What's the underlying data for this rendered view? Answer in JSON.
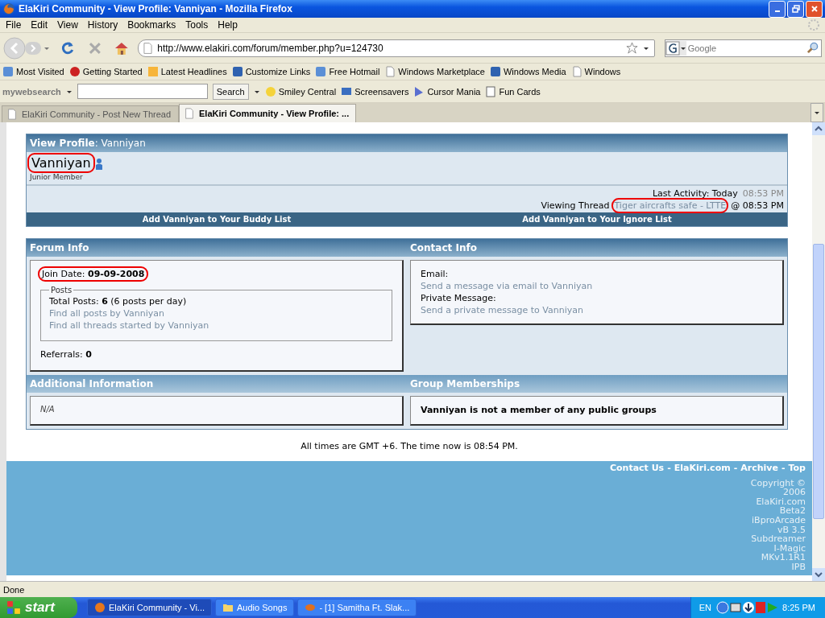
{
  "window": {
    "title": "ElaKiri Community - View Profile: Vanniyan - Mozilla Firefox"
  },
  "menu": [
    "File",
    "Edit",
    "View",
    "History",
    "Bookmarks",
    "Tools",
    "Help"
  ],
  "navigation": {
    "url": "http://www.elakiri.com/forum/member.php?u=124730",
    "search_placeholder": "Google"
  },
  "bookmarks": [
    "Most Visited",
    "Getting Started",
    "Latest Headlines",
    "Customize Links",
    "Free Hotmail",
    "Windows Marketplace",
    "Windows Media",
    "Windows"
  ],
  "search_toolbar": {
    "brand": "mywebsearch",
    "button": "Search",
    "items": [
      "Smiley Central",
      "Screensavers",
      "Cursor Mania",
      "Fun Cards"
    ]
  },
  "tabs": [
    {
      "label": "ElaKiri Community - Post New Thread",
      "selected": false
    },
    {
      "label": "ElaKiri Community - View Profile: ...",
      "selected": true
    }
  ],
  "profile": {
    "header": "**View Profile**: Vanniyan",
    "username": "Vanniyan",
    "rank": "Junior Member",
    "last_activity": "Last Activity: Today",
    "last_activity_time": "08:53 PM",
    "viewing_label": "Viewing Thread",
    "viewing_thread": "Tiger aircrafts safe - LTTE",
    "viewing_time": "@ 08:53 PM",
    "buddy_link": "Add Vanniyan to Your Buddy List",
    "ignore_link": "Add Vanniyan to Your Ignore List"
  },
  "forum_info": {
    "title": "Forum Info",
    "join_date": "Join Date: **09-09-2008**",
    "posts_legend": "Posts",
    "total_posts": "Total Posts: **6** (6 posts per day)",
    "links": [
      "Find all posts by Vanniyan",
      "Find all threads started by Vanniyan"
    ],
    "referrals": "Referrals: **0**"
  },
  "contact_info": {
    "title": "Contact Info",
    "fields": [
      {
        "label": "Email:",
        "link": "Send a message via email to Vanniyan"
      },
      {
        "label": "Private Message:",
        "link": "Send a private message to Vanniyan"
      }
    ]
  },
  "additional_info": {
    "title": "Additional Information",
    "value": "N/A"
  },
  "group_memberships": {
    "title": "Group Memberships",
    "text": "Vanniyan is not a member of any public groups"
  },
  "time_note": "All times are GMT +6. The time now is 08:54 PM.",
  "footer": {
    "links": [
      "Contact Us",
      "ElaKiri.com",
      "Archive",
      "Top"
    ],
    "separator": "-",
    "credits": [
      "Copyright ©",
      "2006",
      "ElaKiri.com",
      "Beta2",
      "iBproArcade",
      "vB 3.5",
      "Subdreamer",
      "I-Magic",
      "MKv1.1R1",
      "IPB"
    ]
  },
  "status_bar": "Done",
  "taskbar": {
    "start": "start",
    "tasks": [
      {
        "label": "ElaKiri Community - Vi...",
        "selected": true
      },
      {
        "label": "Audio Songs",
        "selected": false
      },
      {
        "label": "- [1] Samitha Ft. Slak...",
        "selected": false
      }
    ],
    "language": "EN",
    "clock": "8:25 PM"
  }
}
